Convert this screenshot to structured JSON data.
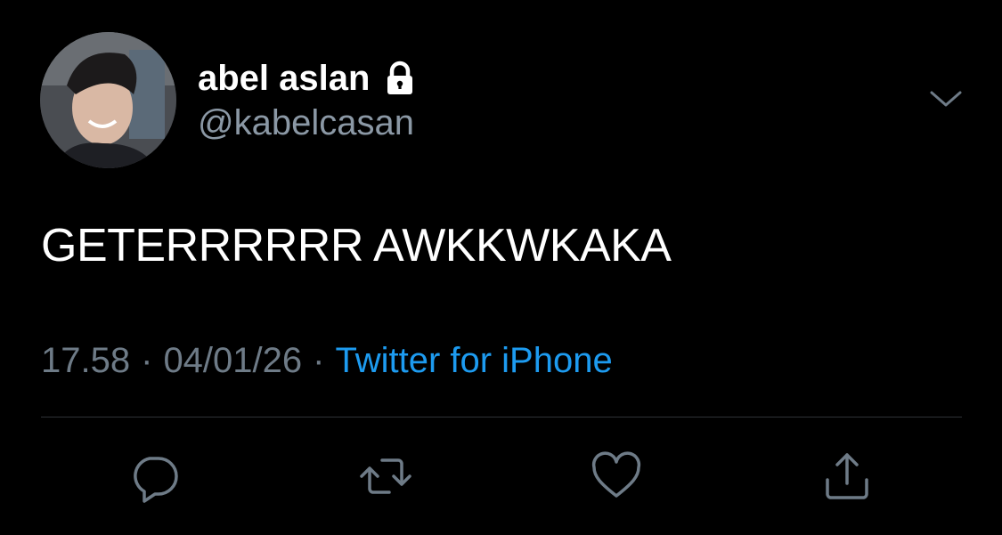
{
  "tweet": {
    "display_name": "abel aslan",
    "handle": "@kabelcasan",
    "text": "GETERRRRRR AWKKWKAKA",
    "time": "17.58",
    "separator": "·",
    "date": "04/01/26",
    "source": "Twitter for iPhone"
  },
  "icons": {
    "lock": "lock-icon",
    "chevron": "chevron-down-icon",
    "reply": "reply-icon",
    "retweet": "retweet-icon",
    "like": "heart-icon",
    "share": "share-icon"
  },
  "colors": {
    "background": "#000000",
    "primary_text": "#ffffff",
    "secondary_text": "#8b98a5",
    "link": "#1d9bf0",
    "divider": "#2f3336"
  }
}
